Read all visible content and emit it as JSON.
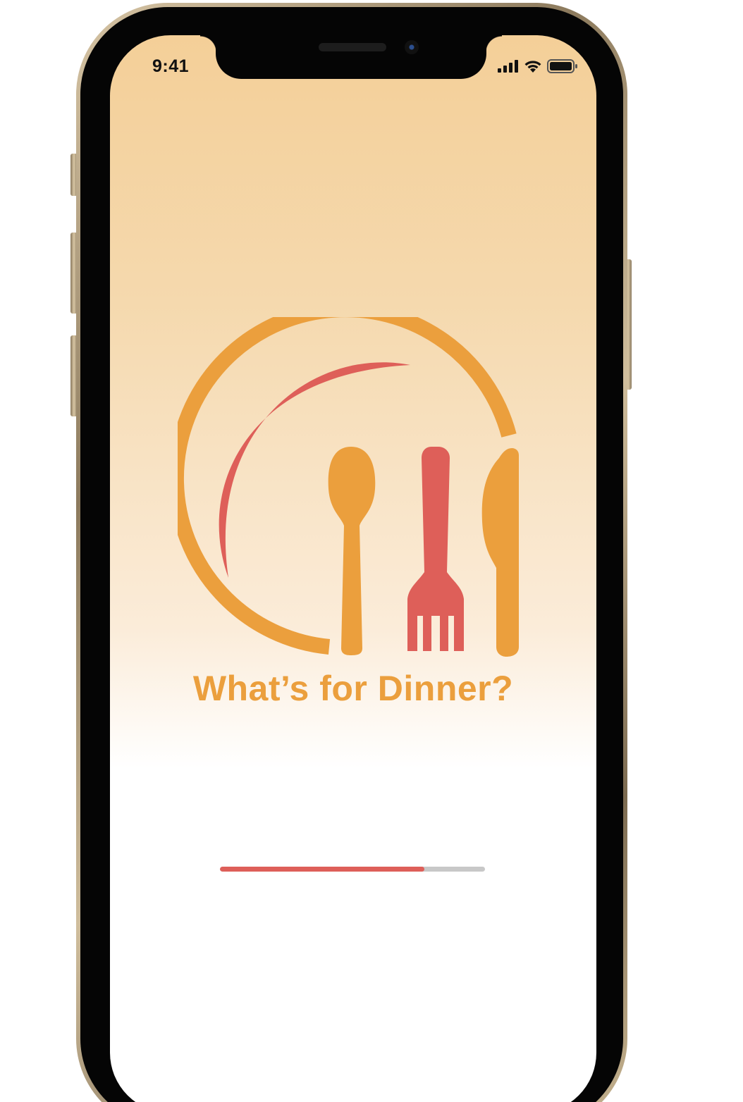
{
  "status_bar": {
    "time": "9:41",
    "icons": [
      "cellular-signal-icon",
      "wifi-icon",
      "battery-icon"
    ]
  },
  "app": {
    "title": "What’s for Dinner?",
    "logo_icon": "plate-spoon-fork-knife-icon"
  },
  "loading": {
    "progress": 0.77
  },
  "colors": {
    "accent_orange": "#eb9f3d",
    "accent_red": "#de5f59",
    "progress_track": "#c8c8c8",
    "background_top": "#f4cf98",
    "background_bottom": "#ffffff"
  }
}
